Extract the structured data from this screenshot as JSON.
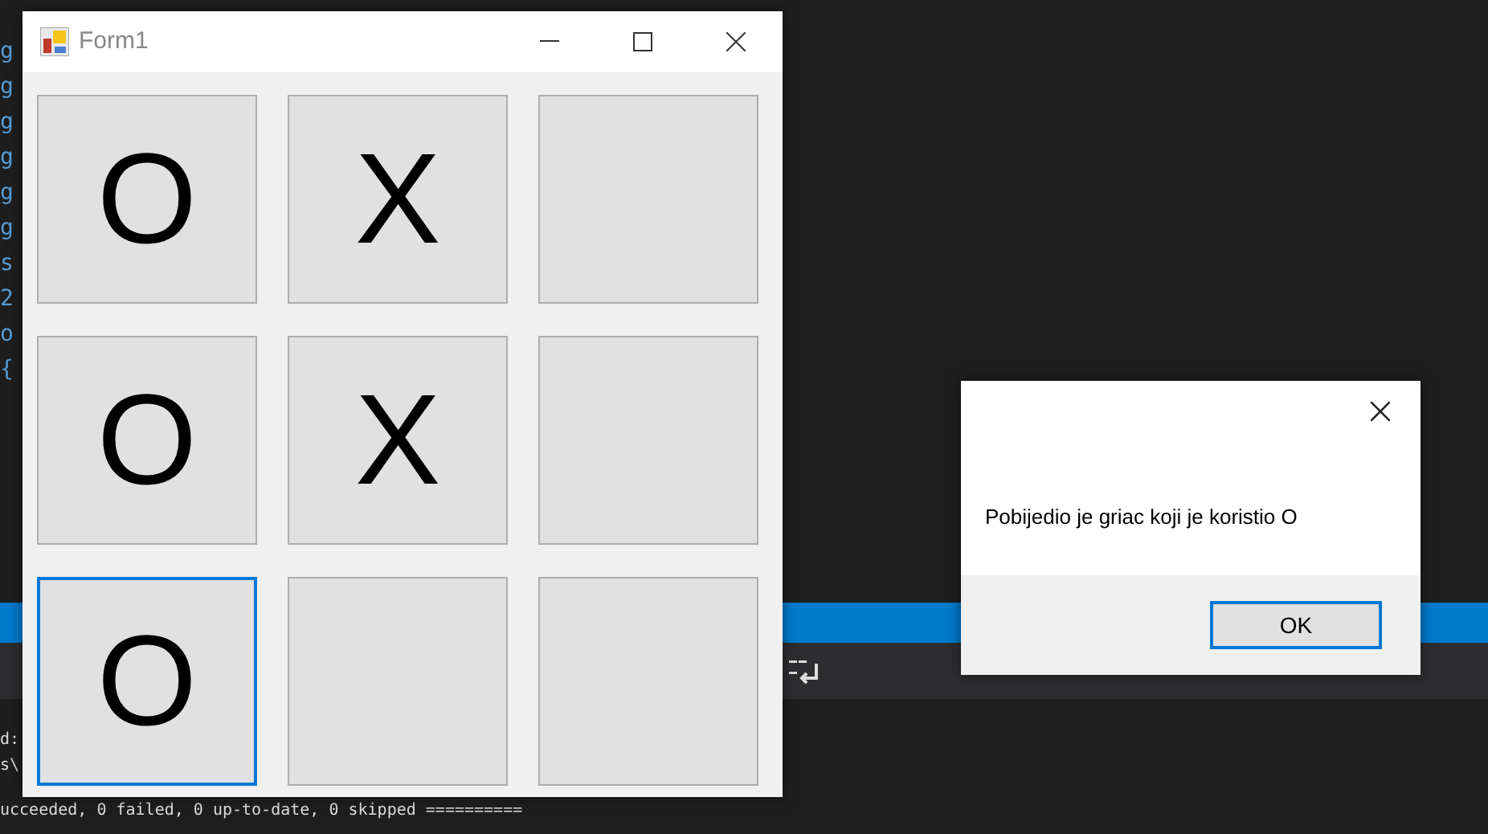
{
  "background": {
    "code_fragments": [
      "g",
      "g",
      "g",
      "g",
      "g",
      "g",
      "s",
      "2",
      "o",
      "{"
    ],
    "output_lines": [
      "d:",
      "s\\",
      "ucceeded, 0 failed, 0 up-to-date, 0 skipped =========="
    ]
  },
  "form": {
    "title": "Form1",
    "cells": [
      {
        "mark": "O",
        "selected": false
      },
      {
        "mark": "X",
        "selected": false
      },
      {
        "selected": false
      },
      {
        "mark": "O",
        "selected": false
      },
      {
        "mark": "X",
        "selected": false
      },
      {
        "selected": false
      },
      {
        "mark": "O",
        "selected": true
      },
      {
        "selected": false
      },
      {
        "selected": false
      }
    ]
  },
  "dialog": {
    "message": "Pobijedio je griac koji je koristio O",
    "button": "OK"
  }
}
